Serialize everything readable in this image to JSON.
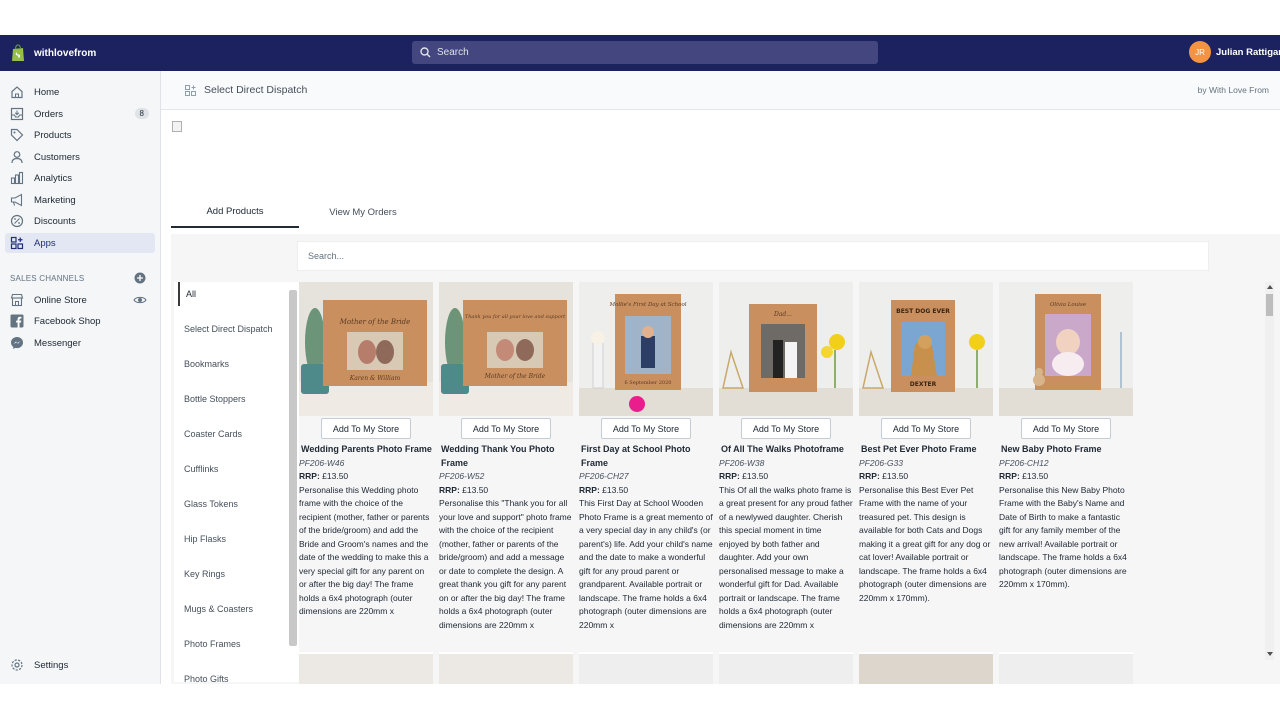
{
  "topbar": {
    "store_name": "withlovefrom",
    "search_placeholder": "Search",
    "user_initials": "JR",
    "user_name": "Julian Rattigan"
  },
  "sidebar": {
    "items": [
      {
        "label": "Home",
        "icon": "home-icon"
      },
      {
        "label": "Orders",
        "icon": "orders-icon",
        "badge": "8"
      },
      {
        "label": "Products",
        "icon": "tag-icon"
      },
      {
        "label": "Customers",
        "icon": "person-icon"
      },
      {
        "label": "Analytics",
        "icon": "chart-icon"
      },
      {
        "label": "Marketing",
        "icon": "megaphone-icon"
      },
      {
        "label": "Discounts",
        "icon": "discount-icon"
      },
      {
        "label": "Apps",
        "icon": "apps-icon",
        "active": true
      }
    ],
    "sales_channels_label": "SALES CHANNELS",
    "channels": [
      {
        "label": "Online Store",
        "icon": "store-icon"
      },
      {
        "label": "Facebook Shop",
        "icon": "facebook-icon"
      },
      {
        "label": "Messenger",
        "icon": "messenger-icon"
      }
    ],
    "settings_label": "Settings"
  },
  "appbar": {
    "title": "Select Direct Dispatch",
    "by": "by With Love From"
  },
  "tabs": {
    "add_products": "Add Products",
    "view_orders": "View My Orders"
  },
  "product_search": {
    "placeholder": "Search..."
  },
  "categories": [
    "All",
    "Select Direct Dispatch",
    "Bookmarks",
    "Bottle Stoppers",
    "Coaster Cards",
    "Cufflinks",
    "Glass Tokens",
    "Hip Flasks",
    "Key Rings",
    "Mugs & Coasters",
    "Photo Frames",
    "Photo Gifts"
  ],
  "add_button_label": "Add To My Store",
  "rrp_label": "RRP:",
  "products": [
    {
      "title": "Wedding Parents Photo Frame",
      "sku": "PF206-W46",
      "price": "£13.50",
      "description": "Personalise this Wedding photo frame with the choice of the recipient (mother, father or parents of the bride/groom) and add the Bride and Groom's names and the date of the wedding to make this a very special gift for any parent on or after the big day! The frame holds a 6x4 photograph (outer dimensions are 220mm x"
    },
    {
      "title": "Wedding Thank You Photo Frame",
      "sku": "PF206-W52",
      "price": "£13.50",
      "description": "Personalise this \"Thank you for all your love and support\" photo frame with the choice of the recipient (mother, father or parents of the bride/groom) and add a message or date to complete the design. A great thank you gift for any parent on or after the big day! The frame holds a 6x4 photograph (outer dimensions are 220mm x"
    },
    {
      "title": "First Day at School Photo Frame",
      "sku": "PF206-CH27",
      "price": "£13.50",
      "description": "This First Day at School Wooden Photo Frame is a great memento of a very special day in any child's (or parent's) life. Add your child's name and the date to make a wonderful gift for any proud parent or grandparent. Available portrait or landscape. The frame holds a 6x4 photograph (outer dimensions are 220mm x"
    },
    {
      "title": "Of All The Walks Photoframe",
      "sku": "PF206-W38",
      "price": "£13.50",
      "description": "This Of all the walks photo frame is a great present for any proud father of a newlywed daughter. Cherish this special moment in time enjoyed by both father and daughter. Add your own personalised message to make a wonderful gift for Dad. Available portrait or landscape. The frame holds a 6x4 photograph (outer dimensions are 220mm x"
    },
    {
      "title": "Best Pet Ever Photo Frame",
      "sku": "PF206-G33",
      "price": "£13.50",
      "description": "Personalise this Best Ever Pet Frame with the name of your treasured pet. This design is available for both Cats and Dogs making it a great gift for any dog or cat lover! Available portrait or landscape. The frame holds a 6x4 photograph (outer dimensions are 220mm x 170mm)."
    },
    {
      "title": "New Baby Photo Frame",
      "sku": "PF206-CH12",
      "price": "£13.50",
      "description": "Personalise this New Baby Photo Frame with the Baby's Name and Date of Birth to make a fantastic gift for any family member of the new arrival! Available portrait or landscape. The frame holds a 6x4 photograph (outer dimensions are 220mm x 170mm)."
    }
  ],
  "frame_texts": {
    "p1_top": "Mother of the Bride",
    "p1_bottom": "Karen & William",
    "p2_top": "Thank you for all your love and support",
    "p2_bottom": "Mother of the Bride",
    "p3_top": "Mollie's First Day at School",
    "p3_bottom": "6 September 2020",
    "p4_top": "Dad...",
    "p5_top": "BEST DOG EVER",
    "p5_bottom": "DEXTER",
    "p6_top": "Olivia Louise"
  },
  "colors": {
    "topbar": "#1c2260",
    "search": "#43467f",
    "avatar": "#f49342",
    "active_nav": "#e3e6f3"
  }
}
